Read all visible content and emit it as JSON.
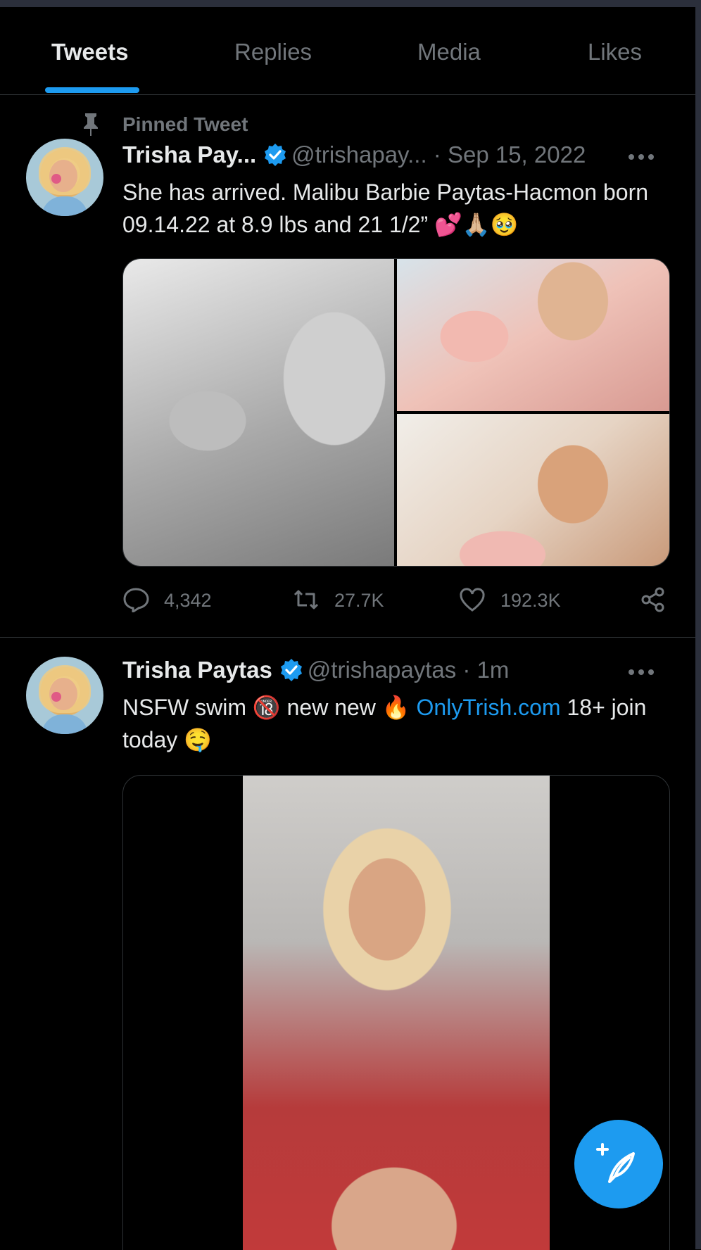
{
  "tabs": [
    {
      "label": "Tweets",
      "active": true
    },
    {
      "label": "Replies",
      "active": false
    },
    {
      "label": "Media",
      "active": false
    },
    {
      "label": "Likes",
      "active": false
    }
  ],
  "colors": {
    "background": "#000000",
    "accent": "#1d9bf0",
    "text": "#e7e9ea",
    "muted": "#71767b",
    "divider": "#2f3336"
  },
  "pinned_tweet": {
    "pinned_label": "Pinned Tweet",
    "name": "Trisha Pay...",
    "handle": "@trishapay...",
    "separator": "·",
    "time": "Sep 15, 2022",
    "text": "She has arrived. Malibu Barbie Paytas-Hacmon born 09.14.22 at 8.9 lbs and 21 1/2” 💕🙏🏼🥹",
    "media_count": 3,
    "replies": "4,342",
    "retweets": "27.7K",
    "likes": "192.3K"
  },
  "second_tweet": {
    "name": "Trisha Paytas",
    "handle": "@trishapaytas",
    "separator": "·",
    "time": "1m",
    "text_before_link": "NSFW swim 🔞 new new 🔥 ",
    "link": "OnlyTrish.com",
    "text_after_link": " 18+ join today 🤤"
  },
  "icons": [
    "pin-icon",
    "verified-badge-icon",
    "more-icon",
    "reply-icon",
    "retweet-icon",
    "like-icon",
    "share-icon",
    "compose-icon"
  ]
}
